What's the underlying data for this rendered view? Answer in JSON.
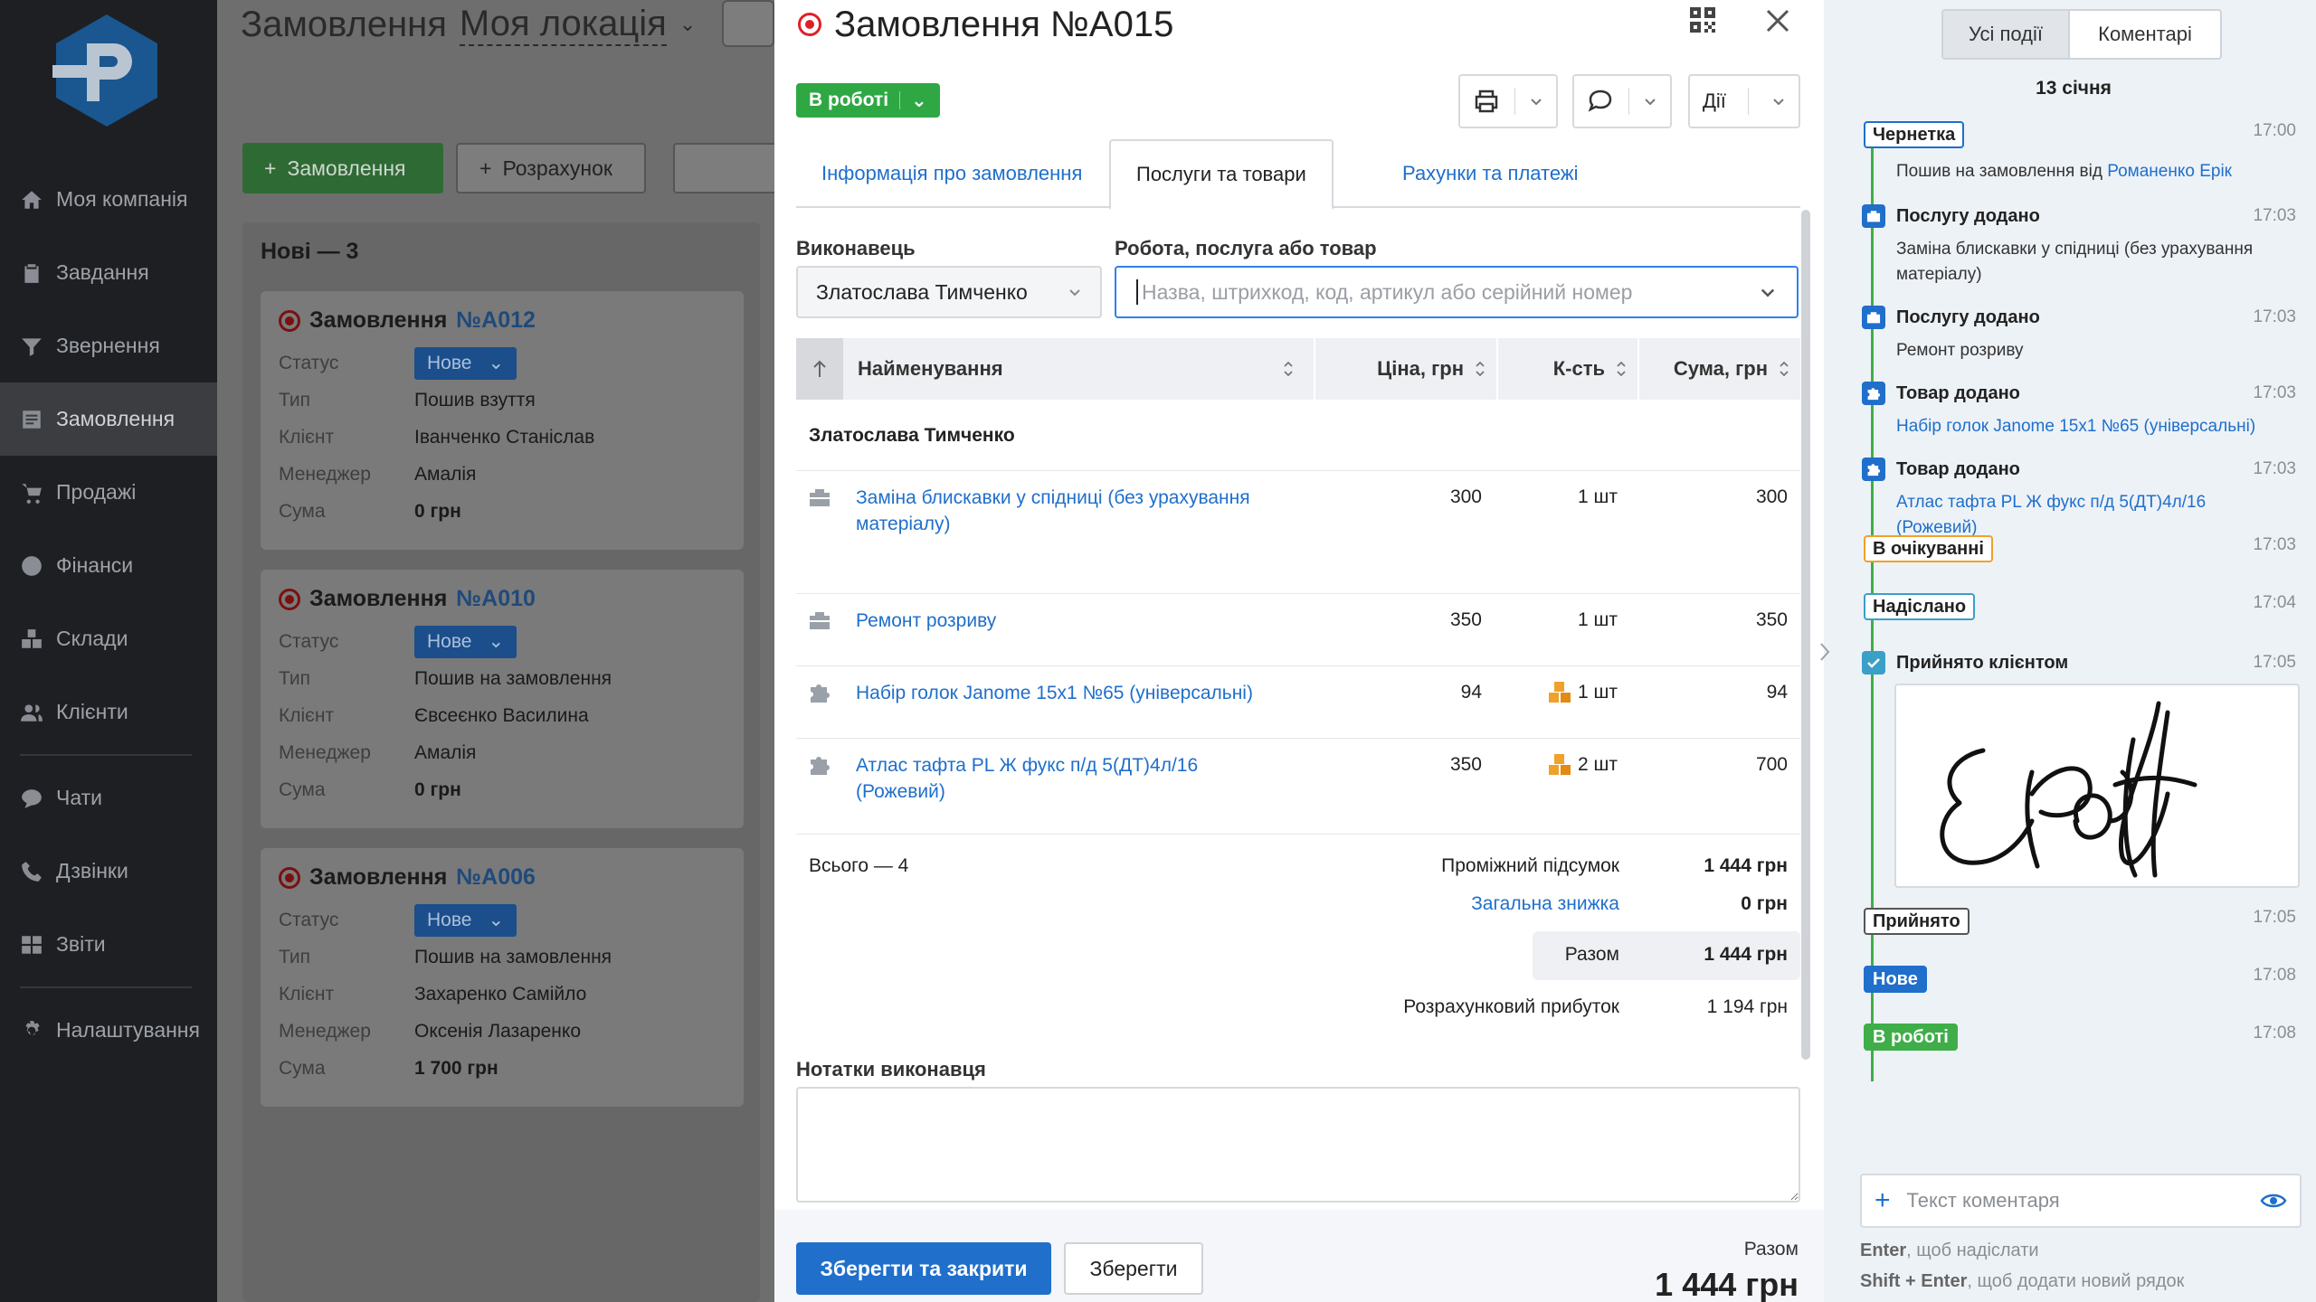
{
  "sidebar": {
    "items": [
      {
        "label": "Моя компанія",
        "icon": "home-icon"
      },
      {
        "label": "Завдання",
        "icon": "clipboard-icon"
      },
      {
        "label": "Звернення",
        "icon": "funnel-icon"
      },
      {
        "label": "Замовлення",
        "icon": "orders-icon",
        "active": true
      },
      {
        "label": "Продажі",
        "icon": "cart-icon"
      },
      {
        "label": "Фінанси",
        "icon": "dollar-icon"
      },
      {
        "label": "Склади",
        "icon": "boxes-icon"
      },
      {
        "label": "Клієнти",
        "icon": "users-icon"
      },
      {
        "label": "Чати",
        "icon": "chat-icon"
      },
      {
        "label": "Дзвінки",
        "icon": "phone-icon"
      },
      {
        "label": "Звіти",
        "icon": "reports-icon"
      },
      {
        "label": "Налаштування",
        "icon": "gear-icon"
      }
    ]
  },
  "background": {
    "title": "Замовлення",
    "location": "Моя локація",
    "add_order": "Замовлення",
    "calculation": "Розрахунок",
    "column_title": "Нові — 3",
    "labels": {
      "status": "Статус",
      "type": "Тип",
      "client": "Клієнт",
      "manager": "Менеджер",
      "sum": "Сума"
    },
    "cards": [
      {
        "prefix": "Замовлення",
        "number": "№A012",
        "status": "Нове",
        "type": "Пошив взуття",
        "client": "Іванченко Станіслав",
        "manager": "Амалія",
        "sum": "0 грн"
      },
      {
        "prefix": "Замовлення",
        "number": "№A010",
        "status": "Нове",
        "type": "Пошив на замовлення",
        "client": "Євсеєнко Василина",
        "manager": "Амалія",
        "sum": "0 грн"
      },
      {
        "prefix": "Замовлення",
        "number": "№A006",
        "status": "Нове",
        "type": "Пошив на замовлення",
        "client": "Захаренко Самійло",
        "manager": "Оксенія Лазаренко",
        "sum": "1 700 грн"
      }
    ]
  },
  "modal": {
    "title": "Замовлення №A015",
    "status": "В роботі",
    "actions_label": "Дії",
    "tabs": [
      "Інформація про замовлення",
      "Послуги та товари",
      "Рахунки та платежі"
    ],
    "executor_label": "Виконавець",
    "executor_value": "Златослава Тимченко",
    "work_label": "Робота, послуга або товар",
    "work_placeholder": "Назва, штрихкод, код, артикул або серійний номер",
    "table": {
      "headers": {
        "name": "Найменування",
        "price": "Ціна, грн",
        "qty": "К-сть",
        "sum": "Сума, грн"
      },
      "group": "Златослава Тимченко",
      "rows": [
        {
          "name": "Заміна блискавки у спідниці (без урахування матеріалу)",
          "price": "300",
          "qty": "1 шт",
          "sum": "300",
          "kind": "service"
        },
        {
          "name": "Ремонт розриву",
          "price": "350",
          "qty": "1 шт",
          "sum": "350",
          "kind": "service"
        },
        {
          "name": "Набір голок Janome 15x1 №65 (універсальні)",
          "price": "94",
          "qty": "1 шт",
          "sum": "94",
          "kind": "product"
        },
        {
          "name": "Атлас тафта PL Ж фукс п/д 5(ДТ)4л/16 (Рожевий)",
          "price": "350",
          "qty": "2 шт",
          "sum": "700",
          "kind": "product"
        }
      ]
    },
    "totals": {
      "count": "Всього — 4",
      "subtotal_label": "Проміжний підсумок",
      "subtotal": "1 444 грн",
      "discount_label": "Загальна знижка",
      "discount": "0 грн",
      "total_label": "Разом",
      "total": "1 444 грн",
      "profit_label": "Розрахунковий прибуток",
      "profit": "1 194 грн"
    },
    "notes_label": "Нотатки виконавця",
    "footer": {
      "save_close": "Зберегти та закрити",
      "save": "Зберегти",
      "total_label": "Разом",
      "total": "1 444 грн"
    }
  },
  "history": {
    "tabs": [
      "Усі події",
      "Коментарі"
    ],
    "date": "13 січня",
    "events": [
      {
        "chip": "Чернетка",
        "time": "17:00",
        "desc": "Пошив на замовлення від ",
        "link": "Романенко Ерік"
      },
      {
        "title": "Послугу додано",
        "time": "17:03",
        "desc": "Заміна блискавки у спідниці (без урахування матеріалу)"
      },
      {
        "title": "Послугу додано",
        "time": "17:03",
        "desc": "Ремонт розриву"
      },
      {
        "title": "Товар додано",
        "time": "17:03",
        "link": "Набір голок Janome 15x1 №65 (універсальні)"
      },
      {
        "title": "Товар додано",
        "time": "17:03",
        "link": "Атлас тафта PL Ж фукс п/д 5(ДТ)4л/16 (Рожевий)"
      },
      {
        "chip": "В очікуванні",
        "time": "17:03"
      },
      {
        "chip": "Надіслано",
        "time": "17:04"
      },
      {
        "title": "Прийнято клієнтом",
        "time": "17:05"
      },
      {
        "chip": "Прийнято",
        "time": "17:05"
      },
      {
        "chip": "Нове",
        "time": "17:08"
      },
      {
        "chip": "В роботі",
        "time": "17:08"
      }
    ],
    "comment_placeholder": "Текст коментаря",
    "hint1_key": "Enter",
    "hint1": ", щоб надіслати",
    "hint2_key": "Shift + Enter",
    "hint2": ", щоб додати новий рядок"
  }
}
